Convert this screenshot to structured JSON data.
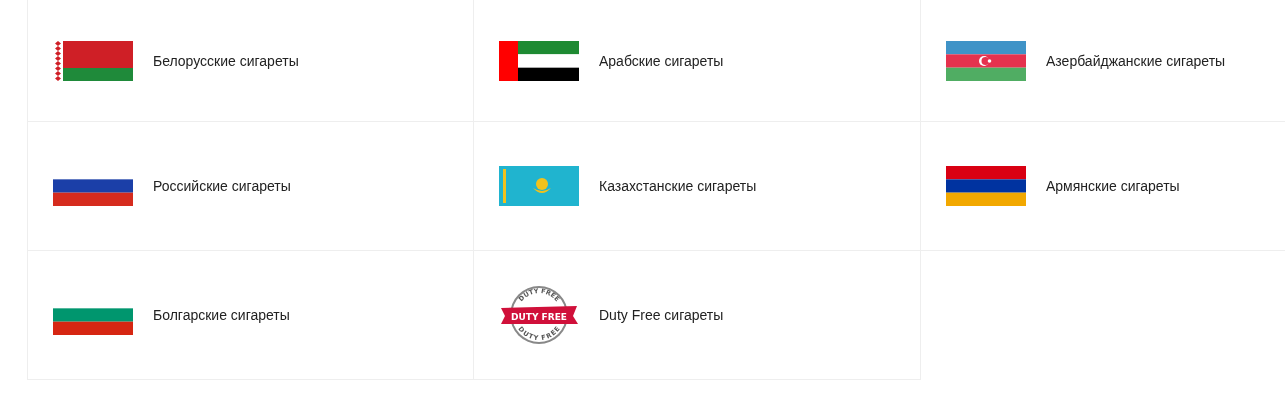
{
  "categories": [
    {
      "label": "Белорусские сигареты",
      "kind": "belarus"
    },
    {
      "label": "Арабские сигареты",
      "kind": "uae"
    },
    {
      "label": "Азербайджанские сигареты",
      "kind": "azerbaijan"
    },
    {
      "label": "Российские сигареты",
      "kind": "russia"
    },
    {
      "label": "Казахстанские сигареты",
      "kind": "kazakhstan"
    },
    {
      "label": "Армянские сигареты",
      "kind": "armenia"
    },
    {
      "label": "Болгарские сигареты",
      "kind": "bulgaria"
    },
    {
      "label": "Duty Free сигареты",
      "kind": "stamp",
      "stamp": {
        "top_arc": "DUTY FREE",
        "ribbon": "DUTY FREE",
        "bottom_arc": "DUTY FREE"
      }
    }
  ]
}
